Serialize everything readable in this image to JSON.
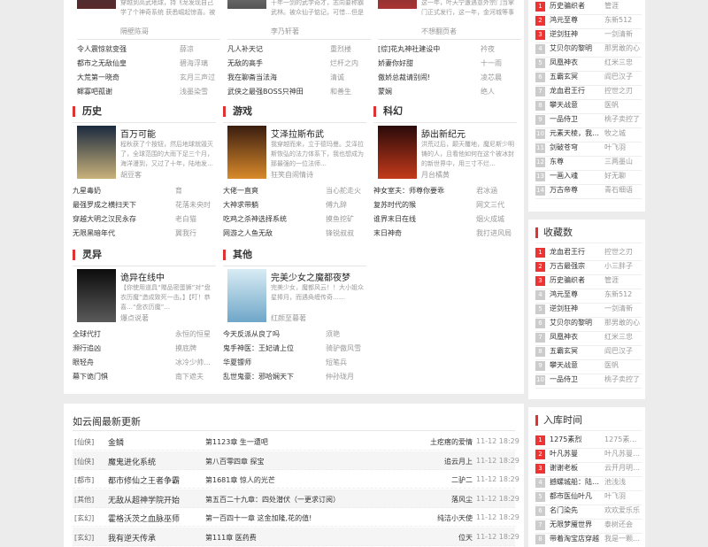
{
  "top_books": [
    {
      "desc": "穿越到高武地球，持飞龙发现自己学了个神奇系统 获悉崛起惊喜。被众生赋宠天地，先抢，我找不怕了…",
      "author": "隔壁陈哥"
    },
    {
      "desc": "十年一剑的武学奇才，志向要称霸武林。被众仙子惦记，可惜…但是高手在修炼之中…",
      "author": "李乃轩著"
    },
    {
      "desc": "这一年，叶天宁遭遇意外宗门当掌门正式发行，这一年，金河城等事奏迎合在美国坠城域年门…",
      "author": "不想翻页者"
    }
  ],
  "top_lists": [
    [
      [
        "令人震惊就变强",
        "薛凉"
      ],
      [
        "都市之无敌仙皇",
        "碧海浮璃"
      ],
      [
        "大荒第一晓奇",
        "玄月三声过"
      ],
      [
        "鳏寡吧孤谢",
        "浅墨染雪"
      ]
    ],
    [
      [
        "凡人补天记",
        "重烈楼"
      ],
      [
        "无敌的高手",
        "烂杆之内"
      ],
      [
        "我在聊斋当法海",
        "清诚"
      ],
      [
        "武侠之最强BOSS只神田",
        "和善生"
      ]
    ],
    [
      [
        "[综]花丸神社建设中",
        "衿夜"
      ],
      [
        "娇妻你好甜",
        "十一雨"
      ],
      [
        "傲娇总裁请别闹!",
        "凌芯晨"
      ],
      [
        "蒙娴",
        "绝人"
      ]
    ]
  ],
  "categories": [
    {
      "name": "历史",
      "book": {
        "title": "百万可能",
        "desc": "程秋获了个按钮，然后地球就毁灭了，全球范围的大雨下足三个月，海洋漫到，又过了十年，陆地发…",
        "author": "胡豆客"
      },
      "list": [
        [
          "九星毒奶",
          "育"
        ],
        [
          "最强罗成之横扫天下",
          "花落未央时"
        ],
        [
          "穿越大明之汉民永存",
          "老白猫"
        ],
        [
          "无限黑暗年代",
          "翼我行"
        ]
      ]
    },
    {
      "name": "游戏",
      "book": {
        "title": "艾泽拉斯布武",
        "desc": "我穿越而来，立于德玛曼。艾泽拉斯恢弘的法力体系下，我也想成为那最强的一位法师…",
        "author": "狂笑自闹情诗"
      },
      "list": [
        [
          "大佬一直爽",
          "当心舵走火"
        ],
        [
          "大神求带躺",
          "傅九辞"
        ],
        [
          "吃鸡之杀神选择系统",
          "摸鱼挖矿"
        ],
        [
          "网游之人鱼无敌",
          "锋锐叔叔"
        ]
      ]
    },
    {
      "name": "科幻",
      "book": {
        "title": "舔出新纪元",
        "desc": "洪荒过后，颠天覆地，魔尼斯少明铸的人，且看他如何在这个被冰封的新世界中，用三寸不烂…",
        "author": "月台橘黄"
      },
      "list": [
        [
          "神女室夫：师尊你要乖",
          "君冰涵"
        ],
        [
          "复苏时代的猴",
          "网文三代"
        ],
        [
          "谁界末日在线",
          "烟火成城"
        ],
        [
          "末日神奇",
          "我打进风局"
        ]
      ]
    },
    {
      "name": "灵异",
      "book": {
        "title": "诡异在线中",
        "desc": "【你使用道具“赠品密蛋狮”对“盘衣历魔”造成致死一击。】【叮！恭喜…“盘衣历魔”…",
        "author": "爆点说著"
      },
      "list": [
        [
          "全球代打",
          "永恒的恒星"
        ],
        [
          "濒行追凶",
          "摸底牌"
        ],
        [
          "眼轻舟",
          "冰冷少帅…"
        ],
        [
          "幕下诡门惧",
          "南下遮夫"
        ]
      ]
    },
    {
      "name": "其他",
      "book": {
        "title": "完美少女之魔都夜梦",
        "desc": "完美少女，魔都风云！！大小姐众星捧月，而遇奂缠传奇……",
        "author": "红颜至暮著"
      },
      "list": [
        [
          "今天反派从良了吗",
          "须艳"
        ],
        [
          "鬼手神医：王妃请上位",
          "骑驴傲风雪"
        ],
        [
          "华夏镖师",
          "短笔兵"
        ],
        [
          "乱世鬼豪：邪哈娴天下",
          "仲孙珑月"
        ]
      ]
    }
  ],
  "rank1": {
    "items": [
      [
        "历史骗织者",
        "管涯"
      ],
      [
        "鸿元至尊",
        "东新512"
      ],
      [
        "逆剑狂神",
        "一剑清新"
      ],
      [
        "艾贝尔的黎明",
        "那男敢的心"
      ],
      [
        "凤凰神衣",
        "红米三忠"
      ],
      [
        "五霸玄冥",
        "阎巴汉子"
      ],
      [
        "龙血君王行",
        "控世之刃"
      ],
      [
        "攀天战意",
        "医帆"
      ],
      [
        "一品侍卫",
        "桃子卖控了"
      ],
      [
        "元素天棱，我…",
        "牧之城"
      ],
      [
        "剑破苍穹",
        "叶飞羽"
      ],
      [
        "东尊",
        "三两墨山"
      ],
      [
        "一画入魂",
        "好无聊"
      ],
      [
        "万古帝尊",
        "青石细语"
      ]
    ]
  },
  "rank2": {
    "title": "收藏数",
    "items": [
      [
        "龙血君王行",
        "控世之刃"
      ],
      [
        "万古最强宗",
        "小三胖子"
      ],
      [
        "历史骗织者",
        "管涯"
      ],
      [
        "鸿元至尊",
        "东新512"
      ],
      [
        "逆剑狂神",
        "一剑清新"
      ],
      [
        "艾贝尔的黎明",
        "那男敢的心"
      ],
      [
        "凤凰神衣",
        "红米三忠"
      ],
      [
        "五霸玄冥",
        "阎巴汉子"
      ],
      [
        "攀天战意",
        "医帆"
      ],
      [
        "一品侍卫",
        "桃子卖控了"
      ]
    ]
  },
  "rank3": {
    "title": "入库时间",
    "items": [
      [
        "1275素烈",
        "1275素…"
      ],
      [
        "叶凡苏曼",
        "叶凡苏曼…"
      ],
      [
        "谢谢老板",
        "云开月明…"
      ],
      [
        "撼螺城船：陆…",
        "池浅浅"
      ],
      [
        "都市医仙叶凡",
        "叶飞羽"
      ],
      [
        "名门染先",
        "欢欢爱乐乐"
      ],
      [
        "无限梦魇世界",
        "泰树还会"
      ],
      [
        "带着淘宝店穿越",
        "我是一颗…"
      ]
    ]
  },
  "latest": {
    "title": "如云阁最新更新",
    "rows": [
      [
        "[仙侠]",
        "金鳞",
        "第1123章 生一遭吧",
        "土疙瘩的爱情",
        "11-12 18:29"
      ],
      [
        "[仙侠]",
        "魔鬼进化系统",
        "第八百零四章 探宝",
        "追云月上",
        "11-12 18:29"
      ],
      [
        "[都市]",
        "都市修仙之王者争霸",
        "第1681章 惊人的光芒",
        "二驴二",
        "11-12 18:29"
      ],
      [
        "[其他]",
        "无敌从超神学院开始",
        "第五百二十九章：四处潜伏（一更求订阅）",
        "落风尘",
        "11-12 18:29"
      ],
      [
        "[玄幻]",
        "霍格沃茨之血脉巫师",
        "第一百四十一章 这金加隆,花的值!",
        "纯洁小天使",
        "11-12 18:29"
      ],
      [
        "[玄幻]",
        "我有逆天传承",
        "第111章 医药费",
        "位天",
        "11-12 18:29"
      ]
    ]
  },
  "colors": {
    "accent": "#dd3333",
    "rank_hot": "#ee3333"
  }
}
